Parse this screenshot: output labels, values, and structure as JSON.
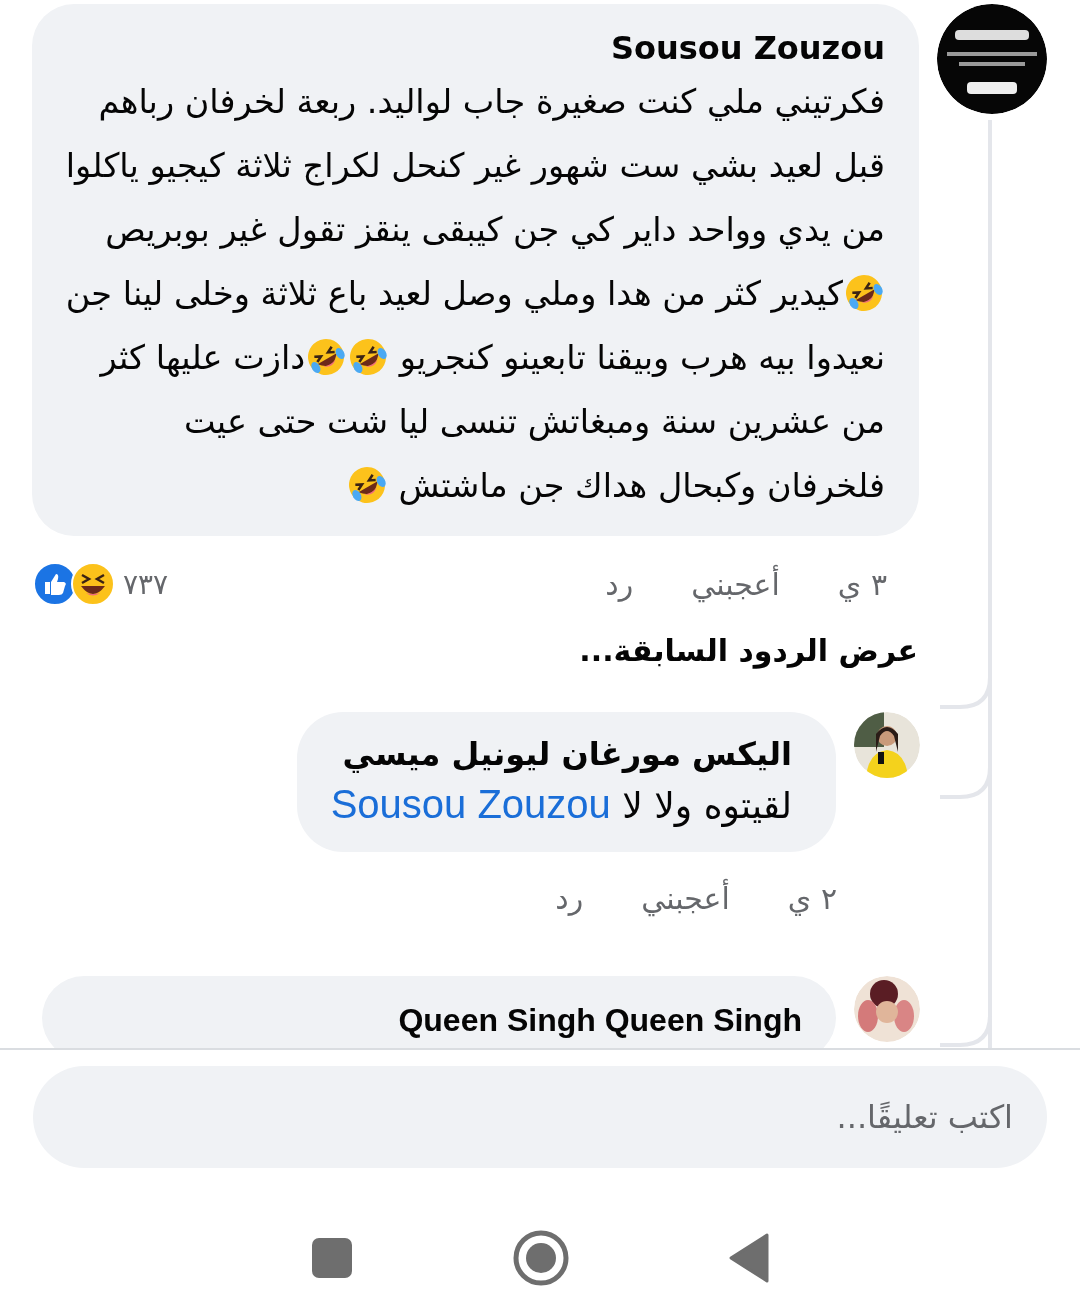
{
  "comment": {
    "author": "Sousou Zouzou",
    "body": [
      {
        "kind": "text",
        "text": "فكرتيني ملي كنت صغيرة جاب لواليد. ربعة لخرفان رباهم قبل لعيد بشي ست شهور غير كنحل لكراج ثلاثة كيجيو ياكلوا من يدي وواحد داير كي جن كيبقى ينقز تقول غير بوبريص"
      },
      {
        "kind": "emoji"
      },
      {
        "kind": "text",
        "text": "كيدير كثر من هدا وملي وصل لعيد باع ثلاثة وخلى لينا جن نعيدوا بيه هرب وبيقنا تابعينو كنجريو"
      },
      {
        "kind": "emoji"
      },
      {
        "kind": "emoji"
      },
      {
        "kind": "text",
        "text": "دازت عليها كثر من عشرين سنة ومبغاتش تنسى ليا شت حتى عيت فلخرفان وكبحال هداك جن ماشتش"
      },
      {
        "kind": "emoji"
      }
    ],
    "time": "٣ ي",
    "like": "أعجبني",
    "reply": "رد",
    "reaction_count": "٧٣٧"
  },
  "view_previous": "عرض الردود السابقة...",
  "replies": [
    {
      "author": "اليكس مورغان ليونيل ميسي",
      "body": [
        {
          "kind": "text",
          "text": "لقيتوه ولا لا"
        },
        {
          "kind": "mention",
          "text": "Sousou Zouzou"
        }
      ],
      "time": "٢ ي",
      "like": "أعجبني",
      "reply": "رد"
    },
    {
      "author": "Queen Singh Queen Singh"
    }
  ],
  "composer": {
    "placeholder": "اكتب تعليقًا..."
  }
}
